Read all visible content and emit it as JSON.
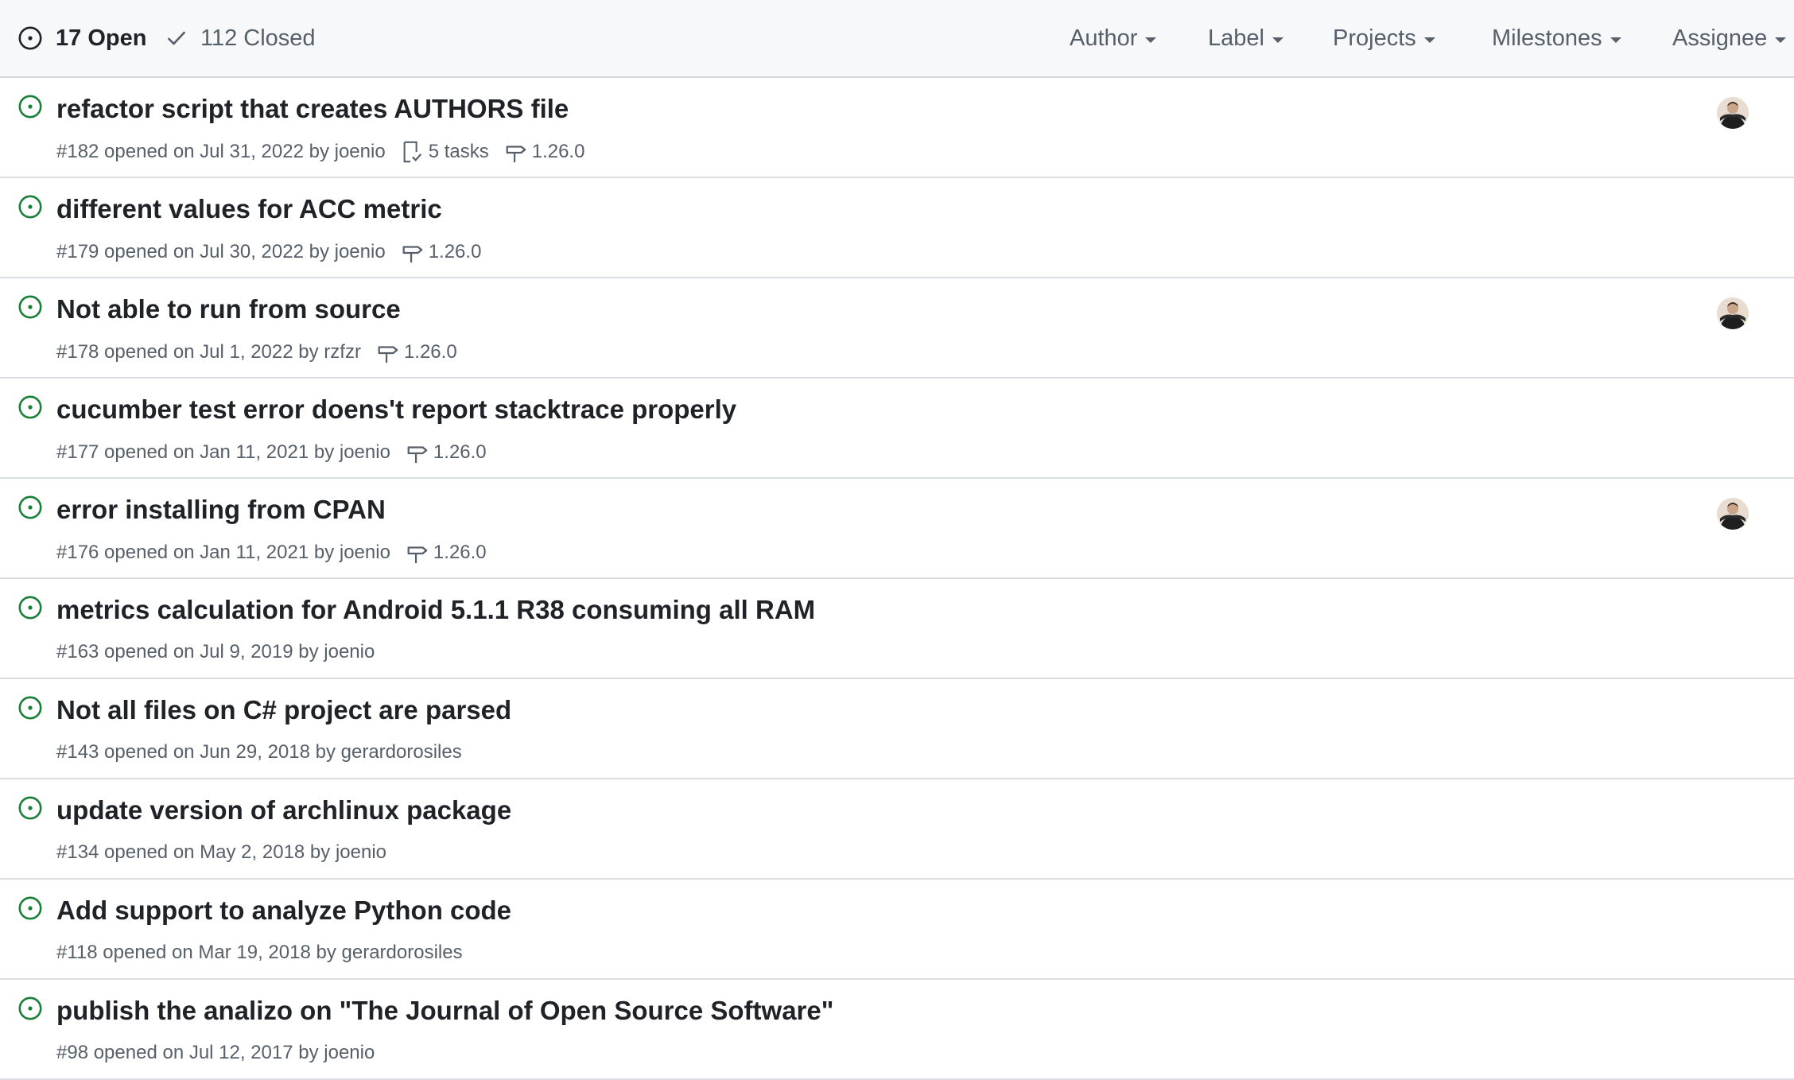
{
  "header": {
    "open_label": "17 Open",
    "closed_label": "112 Closed",
    "filters": [
      "Author",
      "Label",
      "Projects",
      "Milestones",
      "Assignee"
    ]
  },
  "colors": {
    "open_icon": "#1a7f37",
    "title": "#1f2328",
    "muted": "#57606a",
    "header_bg": "#f6f8fa"
  },
  "issues": [
    {
      "title": "refactor script that creates AUTHORS file",
      "meta": "#182 opened on Jul 31, 2022 by joenio",
      "tasks": "5 tasks",
      "milestone": "1.26.0",
      "has_avatar": true
    },
    {
      "title": "different values for ACC metric",
      "meta": "#179 opened on Jul 30, 2022 by joenio",
      "milestone": "1.26.0"
    },
    {
      "title": "Not able to run from source",
      "meta": "#178 opened on Jul 1, 2022 by rzfzr",
      "milestone": "1.26.0",
      "has_avatar": true
    },
    {
      "title": "cucumber test error doens't report stacktrace properly",
      "meta": "#177 opened on Jan 11, 2021 by joenio",
      "milestone": "1.26.0"
    },
    {
      "title": "error installing from CPAN",
      "meta": "#176 opened on Jan 11, 2021 by joenio",
      "milestone": "1.26.0",
      "has_avatar": true
    },
    {
      "title": "metrics calculation for Android 5.1.1 R38 consuming all RAM",
      "meta": "#163 opened on Jul 9, 2019 by joenio"
    },
    {
      "title": "Not all files on C# project are parsed",
      "meta": "#143 opened on Jun 29, 2018 by gerardorosiles"
    },
    {
      "title": "update version of archlinux package",
      "meta": "#134 opened on May 2, 2018 by joenio"
    },
    {
      "title": "Add support to analyze Python code",
      "meta": "#118 opened on Mar 19, 2018 by gerardorosiles"
    },
    {
      "title": "publish the analizo on \"The Journal of Open Source Software\"",
      "meta": "#98 opened on Jul 12, 2017 by joenio"
    }
  ]
}
